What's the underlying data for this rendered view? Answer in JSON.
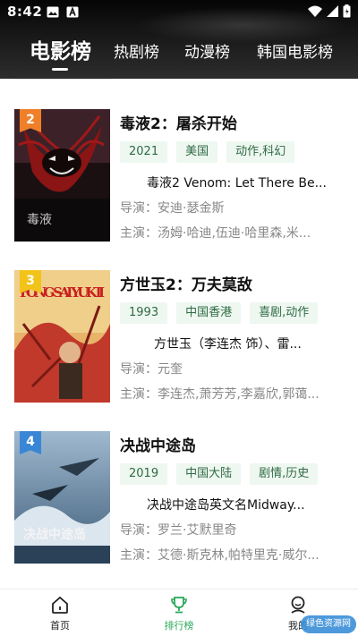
{
  "status": {
    "time": "8:42"
  },
  "tabs": [
    {
      "label": "电影榜",
      "active": true
    },
    {
      "label": "热剧榜",
      "active": false
    },
    {
      "label": "动漫榜",
      "active": false
    },
    {
      "label": "韩国电影榜",
      "active": false
    }
  ],
  "movies": [
    {
      "rank": "2",
      "rank_color": "#f07f2a",
      "title": "毒液2：屠杀开始",
      "tags": [
        "2021",
        "美国",
        "动作,科幻"
      ],
      "desc": "毒液2 Venom: Let There Be...",
      "director": "导演：安迪·瑟金斯",
      "cast": "主演：汤姆·哈迪,伍迪·哈里森,米...",
      "poster_text": "毒液"
    },
    {
      "rank": "3",
      "rank_color": "#f2c318",
      "title": "方世玉2：万夫莫敌",
      "tags": [
        "1993",
        "中国香港",
        "喜剧,动作"
      ],
      "desc": "方世玉（李连杰 饰）、雷...",
      "director": "导演：元奎",
      "cast": "主演：李连杰,萧芳芳,李嘉欣,郭蔼...",
      "poster_text": "FONG SAI YUK II"
    },
    {
      "rank": "4",
      "rank_color": "#3a86d6",
      "title": "决战中途岛",
      "tags": [
        "2019",
        "中国大陆",
        "剧情,历史"
      ],
      "desc": "决战中途岛英文名Midway...",
      "director": "导演：罗兰·艾默里奇",
      "cast": "主演：艾德·斯克林,帕特里克·威尔...",
      "poster_text": "决战中途岛"
    }
  ],
  "bottom_nav": [
    {
      "label": "首页",
      "icon": "home-icon",
      "active": false
    },
    {
      "label": "排行榜",
      "icon": "trophy-icon",
      "active": true
    },
    {
      "label": "我的",
      "icon": "profile-icon",
      "active": false
    }
  ],
  "watermark": "绿色资源网",
  "colors": {
    "accent": "#2aa85a",
    "tag_bg": "#eef7f0",
    "tag_text": "#2e6b44"
  }
}
